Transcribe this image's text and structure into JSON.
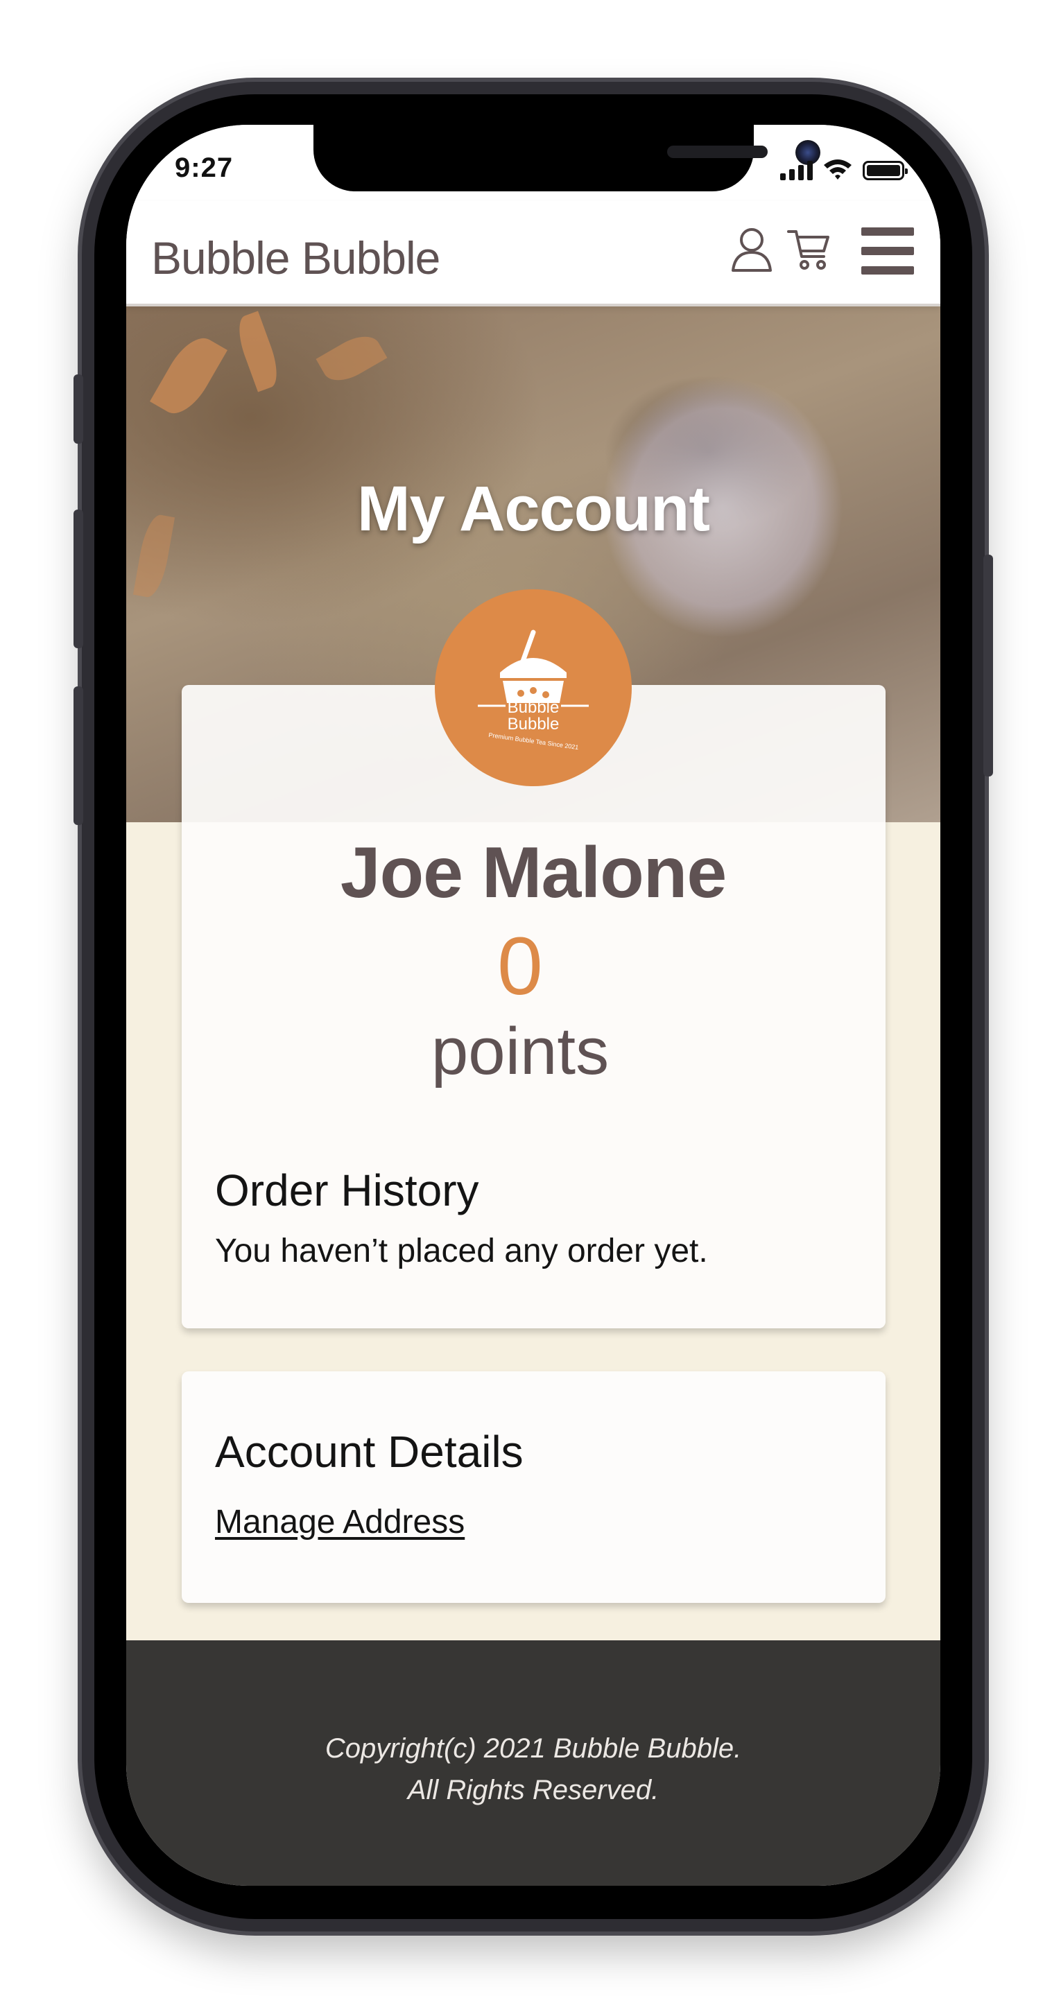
{
  "status_bar": {
    "time": "9:27"
  },
  "header": {
    "brand": "Bubble Bubble",
    "icons": [
      "user-icon",
      "cart-icon",
      "hamburger-menu-icon"
    ]
  },
  "hero": {
    "title": "My Account"
  },
  "logo": {
    "line1": "Bubble",
    "line2": "Bubble",
    "tagline": "Premium Bubble Tea Since 2021"
  },
  "profile": {
    "name": "Joe Malone",
    "points_value": "0",
    "points_label": "points"
  },
  "order_history": {
    "title": "Order History",
    "empty_text": "You haven’t placed any order yet."
  },
  "account_details": {
    "title": "Account Details",
    "manage_address": "Manage Address"
  },
  "footer": {
    "copyright_line1": "Copyright(c) 2021 Bubble Bubble.",
    "copyright_line2": "All Rights Reserved."
  },
  "colors": {
    "brand_text": "#5f5253",
    "accent_orange": "#dd8a48",
    "content_bg": "#f6f0e0",
    "footer_bg": "#373634"
  }
}
